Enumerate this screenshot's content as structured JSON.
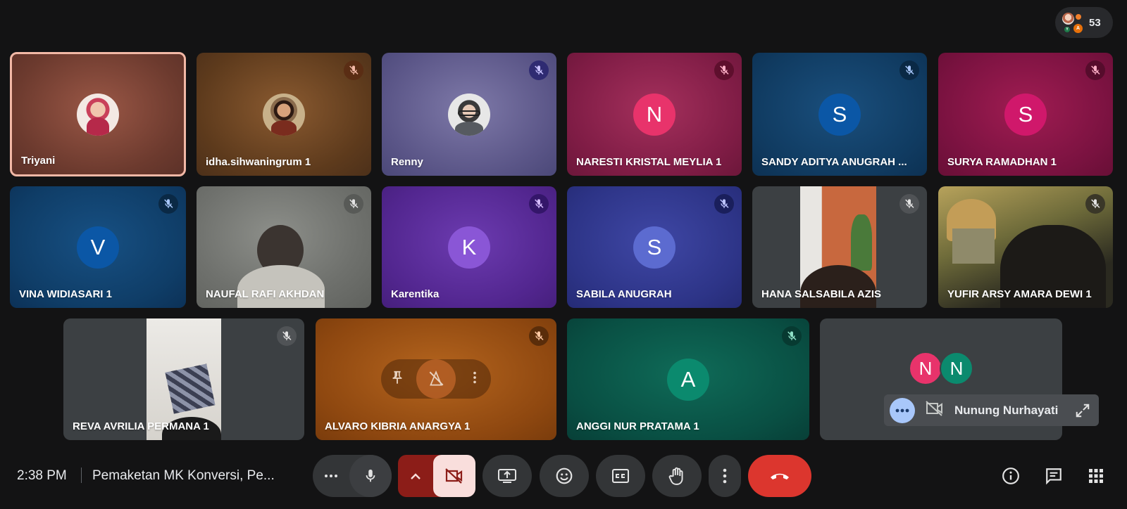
{
  "participant_count": "53",
  "count_avatars": {
    "a": "Y",
    "b": "A"
  },
  "tiles": [
    {
      "name": "Triyani",
      "avatar": "photo"
    },
    {
      "name": "idha.sihwaningrum 1",
      "avatar": "photo"
    },
    {
      "name": "Renny",
      "avatar": "photo"
    },
    {
      "name": "NARESTI KRISTAL MEYLIA 1",
      "initial": "N",
      "avatar_color": "#e8336b"
    },
    {
      "name": "SANDY ADITYA ANUGRAH ...",
      "initial": "S",
      "avatar_color": "#0b57a6"
    },
    {
      "name": "SURYA RAMADHAN 1",
      "initial": "S",
      "avatar_color": "#d0186b"
    },
    {
      "name": "VINA WIDIASARI 1",
      "initial": "V",
      "avatar_color": "#0b57a6"
    },
    {
      "name": "NAUFAL RAFI AKHDAN",
      "avatar": "video"
    },
    {
      "name": "Karentika",
      "initial": "K",
      "avatar_color": "#8a56d6"
    },
    {
      "name": "SABILA ANUGRAH",
      "initial": "S",
      "avatar_color": "#5c6bd0"
    },
    {
      "name": "HANA SALSABILA AZIS",
      "avatar": "video"
    },
    {
      "name": "YUFIR ARSY AMARA DEWI 1",
      "avatar": "video"
    },
    {
      "name": "REVA AVRILIA PERMANA 1",
      "avatar": "video"
    },
    {
      "name": "ALVARO KIBRIA ANARGYA 1",
      "avatar": "none"
    },
    {
      "name": "ANGGI NUR PRATAMA 1",
      "initial": "A",
      "avatar_color": "#0b8a6e"
    }
  ],
  "others_tile": {
    "initials": [
      "N",
      "N"
    ],
    "name": "Nunung Nurhayati"
  },
  "bottom_bar": {
    "time": "2:38 PM",
    "meeting_title": "Pemaketan MK Konversi, Pe..."
  },
  "colors": {
    "background": "#131314",
    "end_call": "#dc362e",
    "camera_off": "#8c1d18",
    "active_speaker_border": "#f2b8a6"
  },
  "icons": {
    "mute": "mic-off-icon",
    "camera_off": "videocam-off-icon",
    "end_call": "call-end-icon"
  }
}
